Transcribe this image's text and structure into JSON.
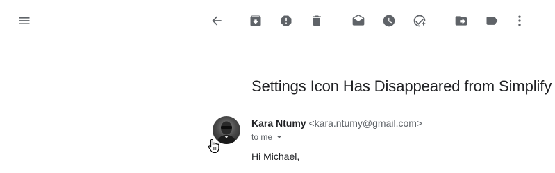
{
  "toolbar": {
    "menu_icon": "menu-icon",
    "buttons": [
      "back-arrow-icon",
      "archive-icon",
      "report-spam-icon",
      "delete-icon",
      "mark-unread-icon",
      "snooze-icon",
      "add-to-tasks-icon",
      "move-to-icon",
      "labels-icon",
      "more-options-icon"
    ]
  },
  "message": {
    "subject": "Settings Icon Has Disappeared from Simplify",
    "sender_name": "Kara Ntumy",
    "sender_email": "<kara.ntumy@gmail.com>",
    "recipient": "to me",
    "greeting": "Hi Michael,"
  }
}
